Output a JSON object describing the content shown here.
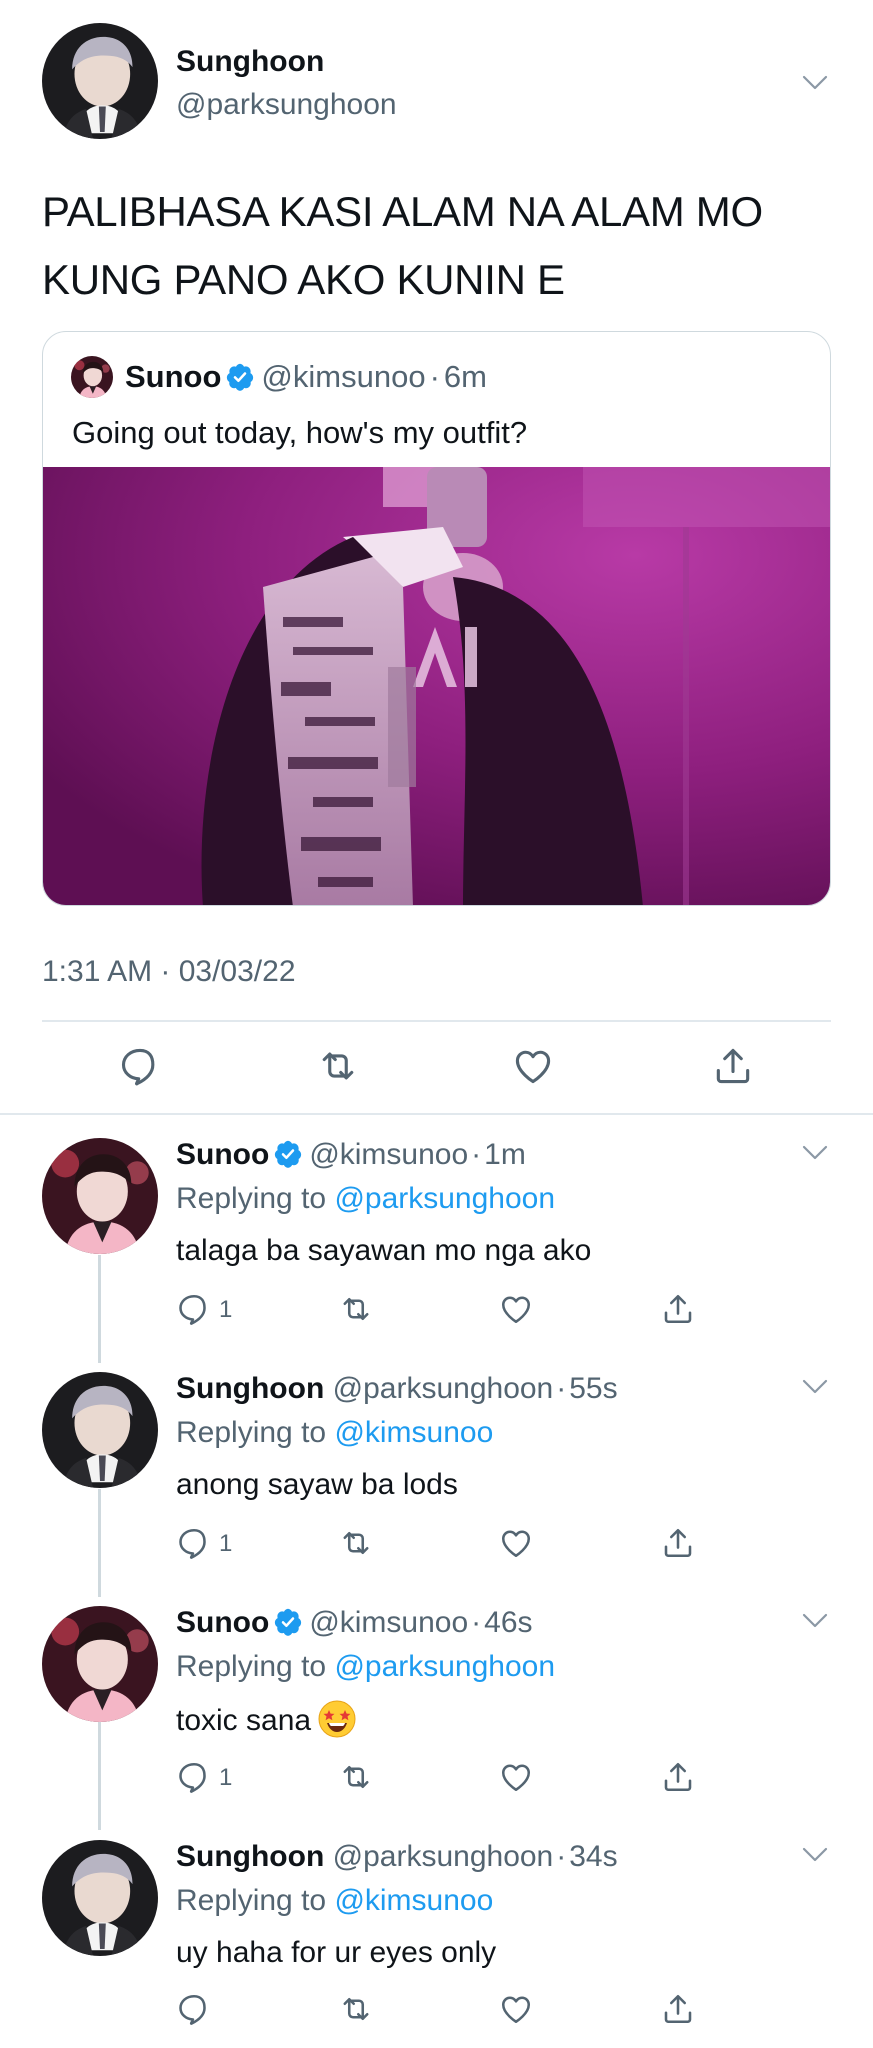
{
  "main_tweet": {
    "display_name": "Sunghoon",
    "handle": "@parksunghoon",
    "text_line1": "PALIBHASA KASI ALAM NA ALAM MO",
    "text_line2": "KUNG PANO AKO KUNIN E",
    "timestamp": "1:31 AM · 03/03/22",
    "avatar_icon": "avatar-sunghoon",
    "quote": {
      "display_name": "Sunoo",
      "handle": "@kimsunoo",
      "separator": "·",
      "time": "6m",
      "text": "Going out today, how's my outfit?",
      "media": "photo"
    }
  },
  "icons": {
    "reply": "reply-icon",
    "retweet": "retweet-icon",
    "like": "heart-icon",
    "share": "share-icon",
    "more": "chevron-down-icon",
    "verified": "verified-badge-icon"
  },
  "colors": {
    "link": "#1d9bf0",
    "muted": "#536471",
    "divider": "#e1e8ed",
    "thread": "#cfd9de"
  },
  "replies": [
    {
      "display_name": "Sunoo",
      "verified": true,
      "handle": "@kimsunoo",
      "separator": "·",
      "time": "1m",
      "replying_prefix": "Replying to",
      "replying_to": "@parksunghoon",
      "text": "talaga ba sayawan mo nga ako",
      "reply_count": "1"
    },
    {
      "display_name": "Sunghoon",
      "verified": false,
      "handle": "@parksunghoon",
      "separator": "·",
      "time": "55s",
      "replying_prefix": "Replying to",
      "replying_to": "@kimsunoo",
      "text": "anong sayaw ba lods",
      "reply_count": "1"
    },
    {
      "display_name": "Sunoo",
      "verified": true,
      "handle": "@kimsunoo",
      "separator": "·",
      "time": "46s",
      "replying_prefix": "Replying to",
      "replying_to": "@parksunghoon",
      "text": "toxic sana",
      "emoji": "star-struck-emoji",
      "reply_count": "1"
    },
    {
      "display_name": "Sunghoon",
      "verified": false,
      "handle": "@parksunghoon",
      "separator": "·",
      "time": "34s",
      "replying_prefix": "Replying to",
      "replying_to": "@kimsunoo",
      "text": "uy haha for ur eyes only",
      "reply_count": ""
    }
  ]
}
